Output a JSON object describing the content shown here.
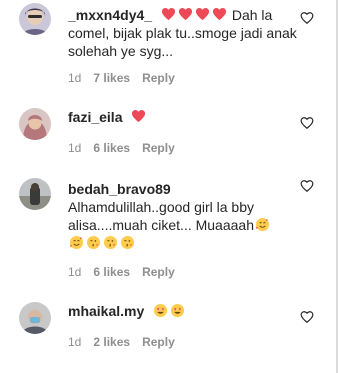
{
  "comments": [
    {
      "username": "_mxxn4dy4_",
      "text": "Dah la comel, bijak plak tu..smoge jadi anak solehah ye syg...",
      "time": "1d",
      "likes": "7 likes",
      "reply": "Reply",
      "avatar_icon": "user-avatar-icon",
      "emoji_icons": [
        "red-heart-icon",
        "red-heart-icon",
        "red-heart-icon",
        "red-heart-icon"
      ]
    },
    {
      "username": "fazi_eila",
      "text": "",
      "time": "1d",
      "likes": "6 likes",
      "reply": "Reply",
      "avatar_icon": "user-avatar-icon",
      "emoji_icons": [
        "red-heart-icon"
      ]
    },
    {
      "username": "bedah_bravo89",
      "text": "Alhamdulillah..good girl la bby alisa....muah ciket... Muaaaah",
      "time": "1d",
      "likes": "6 likes",
      "reply": "Reply",
      "avatar_icon": "user-avatar-icon",
      "emoji_icons": [
        "smiling-face-with-hearts-icon",
        "smiling-face-with-hearts-icon",
        "face-blowing-kiss-icon",
        "face-blowing-kiss-icon",
        "face-blowing-kiss-icon"
      ]
    },
    {
      "username": "mhaikal.my",
      "text": "",
      "time": "1d",
      "likes": "2 likes",
      "reply": "Reply",
      "avatar_icon": "user-avatar-icon",
      "emoji_icons": [
        "smiling-face-with-heart-eyes-icon",
        "smiling-face-with-heart-eyes-icon"
      ]
    }
  ],
  "like_button_icon": "heart-outline-icon",
  "colors": {
    "text": "#262626",
    "meta": "#8e8e8e",
    "heart": "#ed4956",
    "emoji_face": "#ffcc4d"
  }
}
